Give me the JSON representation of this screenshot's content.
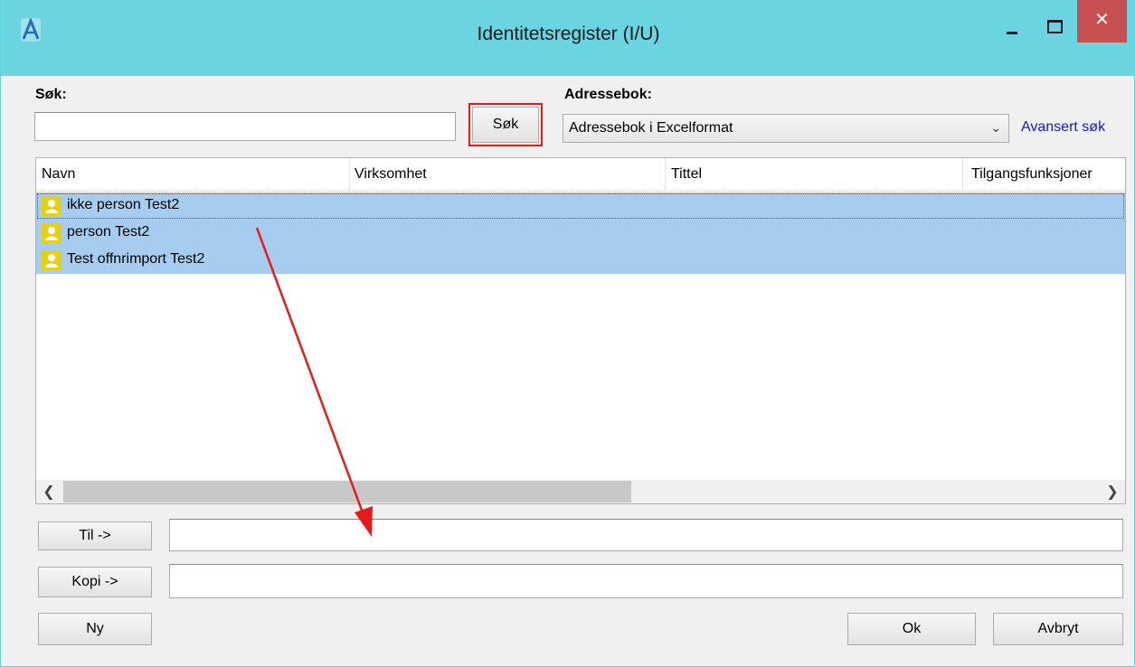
{
  "window": {
    "title": "Identitetsregister (I/U)",
    "close_glyph": "✕"
  },
  "search": {
    "label": "Søk:",
    "value": "",
    "button_label": "Søk"
  },
  "addressbook": {
    "label": "Adressebok:",
    "selected": "Adressebok i Excelformat",
    "advanced_link": "Avansert søk"
  },
  "list": {
    "columns": [
      "Navn",
      "Virksomhet",
      "Tittel",
      "Tilgangsfunksjoner"
    ],
    "rows": [
      {
        "name": "ikke person Test2",
        "selected": true,
        "focused": true
      },
      {
        "name": "person Test2",
        "selected": true,
        "focused": false
      },
      {
        "name": "Test offnrimport Test2",
        "selected": true,
        "focused": false
      }
    ]
  },
  "recipients": {
    "to_label": "Til ->",
    "to_value": "",
    "cc_label": "Kopi ->",
    "cc_value": ""
  },
  "footer": {
    "new_label": "Ny",
    "ok_label": "Ok",
    "cancel_label": "Avbryt"
  },
  "colors": {
    "titlebar": "#6ad4e0",
    "close_button": "#c75050",
    "selection": "#a6cdf0",
    "annotation": "#e51b1b",
    "link": "#1515d8",
    "person_icon": "#e7cf17"
  }
}
